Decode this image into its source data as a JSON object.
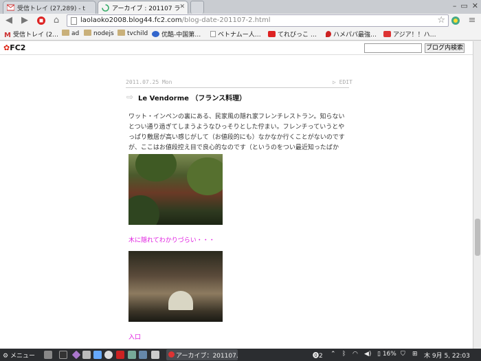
{
  "tabs": [
    {
      "label": "受信トレイ (27,289) - t",
      "favicon": "gmail-icon",
      "active": false
    },
    {
      "label": "アーカイブ : 201107 ラ",
      "favicon": "loading-icon",
      "active": true
    }
  ],
  "toolbar": {
    "url_host": "laolaoko2008.blog44.fc2.com",
    "url_path": "/blog-date-201107-2.html"
  },
  "bookmarks": [
    {
      "label": "受信トレイ (2…",
      "icon": "gmail-icon"
    },
    {
      "label": "ad",
      "icon": "folder-icon"
    },
    {
      "label": "nodejs",
      "icon": "folder-icon"
    },
    {
      "label": "tvchild",
      "icon": "folder-icon"
    },
    {
      "label": "优酷-中国第…",
      "icon": "youku-icon"
    },
    {
      "label": "ベトナムー人…",
      "icon": "page-icon"
    },
    {
      "label": "てれびっこ …",
      "icon": "youtube-icon"
    },
    {
      "label": "ハメパパ最強…",
      "icon": "pin-icon"
    },
    {
      "label": "アジア！！ハ…",
      "icon": "fc2-icon"
    }
  ],
  "fc2": {
    "logo": "FC2",
    "search_button": "ブログ内検索"
  },
  "post": {
    "date": "2011.07.25 Mon",
    "edit": "EDIT",
    "title": "Le Vendorme （フランス料理）",
    "body": "ワット・インペンの裏にある、民家風の隠れ家フレンチレストラン。知らないとつい通り過ぎてしまうようなひっそりとした佇まい。フレンチっていうとやっぱり敷居が高い感じがして（お値段的にも）なかなか行くことがないのですが、ここはお値段控え目で良心的なのです（というのをつい最近知ったばかり）。",
    "caption1": "木に隠れてわかりづらい・・・",
    "caption2": "入口"
  },
  "taskbar": {
    "menu": "メニュー",
    "task": "アーカイブ：201107…",
    "notif": "2",
    "battery": "16%",
    "clock": "木 9月 5, 22:03"
  }
}
